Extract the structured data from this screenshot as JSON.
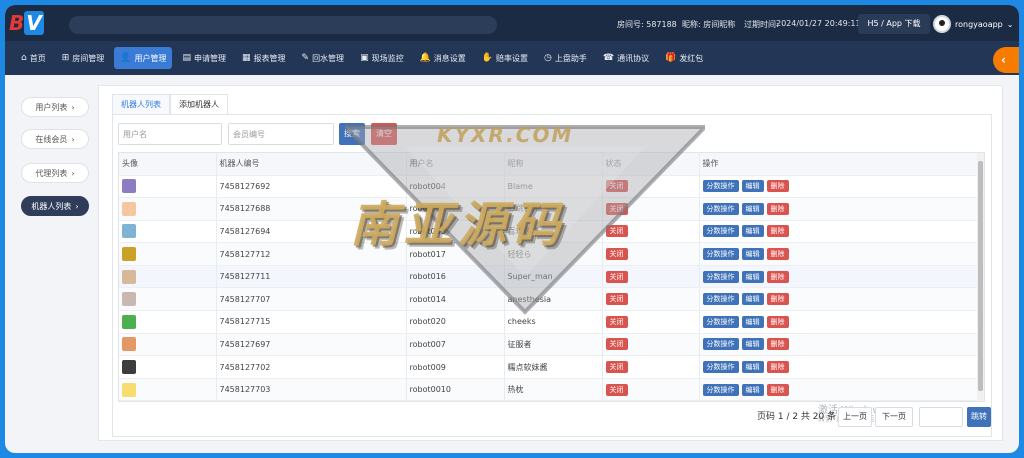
{
  "header": {
    "logo_b": "B",
    "logo_v": "V",
    "room_no": "房间号: 587188",
    "nickname": "昵称: 房间昵称",
    "expire_label": "过期时间:",
    "expire_value": "2024/01/27 20:49:11",
    "h5_button": "H5 / App 下载",
    "username": "rongyaoapp"
  },
  "nav": [
    {
      "icon": "⌂",
      "label": "首页"
    },
    {
      "icon": "⊞",
      "label": "房间管理"
    },
    {
      "icon": "👤",
      "label": "用户管理"
    },
    {
      "icon": "▤",
      "label": "申请管理"
    },
    {
      "icon": "▦",
      "label": "报表管理"
    },
    {
      "icon": "✎",
      "label": "回水管理"
    },
    {
      "icon": "▣",
      "label": "现场监控"
    },
    {
      "icon": "🔔",
      "label": "消息设置"
    },
    {
      "icon": "✋",
      "label": "赔率设置"
    },
    {
      "icon": "◷",
      "label": "上盘助手"
    },
    {
      "icon": "☎",
      "label": "通讯协议"
    },
    {
      "icon": "🎁",
      "label": "发红包"
    }
  ],
  "sidebar": {
    "items": [
      {
        "label": "用户列表"
      },
      {
        "label": "在线会员"
      },
      {
        "label": "代理列表"
      },
      {
        "label": "机器人列表"
      }
    ]
  },
  "tabs": [
    {
      "label": "机器人列表"
    },
    {
      "label": "添加机器人"
    }
  ],
  "filters": {
    "username_placeholder": "用户名",
    "member_placeholder": "会员编号",
    "search_label": "搜索",
    "clear_label": "清空"
  },
  "table": {
    "headers": [
      "头像",
      "机器人编号",
      "用户名",
      "昵称",
      "状态",
      "操作"
    ],
    "status_label": "关闭",
    "op_labels": [
      "分数操作",
      "编辑",
      "删除"
    ],
    "rows": [
      {
        "id": "7458127692",
        "user": "robot004",
        "nick": "Blame",
        "avatar": "#8e7cc3"
      },
      {
        "id": "7458127688",
        "user": "robot001",
        "nick": "心跳暂停",
        "avatar": "#f4c7a1"
      },
      {
        "id": "7458127694",
        "user": "robot005",
        "nick": "喜欢哪吒",
        "avatar": "#7fb3d5"
      },
      {
        "id": "7458127712",
        "user": "robot017",
        "nick": "轻轻ら",
        "avatar": "#c9a227"
      },
      {
        "id": "7458127711",
        "user": "robot016",
        "nick": "Super_man",
        "avatar": "#d7b899"
      },
      {
        "id": "7458127707",
        "user": "robot014",
        "nick": "anesthesia",
        "avatar": "#c9b8b0"
      },
      {
        "id": "7458127715",
        "user": "robot020",
        "nick": "cheeks",
        "avatar": "#4caf50"
      },
      {
        "id": "7458127697",
        "user": "robot007",
        "nick": "征服者",
        "avatar": "#e59866"
      },
      {
        "id": "7458127702",
        "user": "robot009",
        "nick": "糯点软妹酱",
        "avatar": "#3d3d3d"
      },
      {
        "id": "7458127703",
        "user": "robot0010",
        "nick": "热枕",
        "avatar": "#f7dc6f"
      }
    ]
  },
  "pager": {
    "info": "页码 1 / 2 共 20 条",
    "prev": "上一页",
    "next": "下一页",
    "jump": "跳转"
  },
  "watermark": {
    "top": "KYXR.COM",
    "main": "南亚源码",
    "windows_line1": "激活 Windows",
    "windows_line2": "转到“设置”以激活 Windows。"
  },
  "colors": {
    "frame": "#1e88e5",
    "header": "#1c2b44",
    "nav": "#233655",
    "active_nav": "#3a7bd5",
    "danger": "#d9534f",
    "primary": "#3f72b8",
    "orange": "#f57c00"
  }
}
